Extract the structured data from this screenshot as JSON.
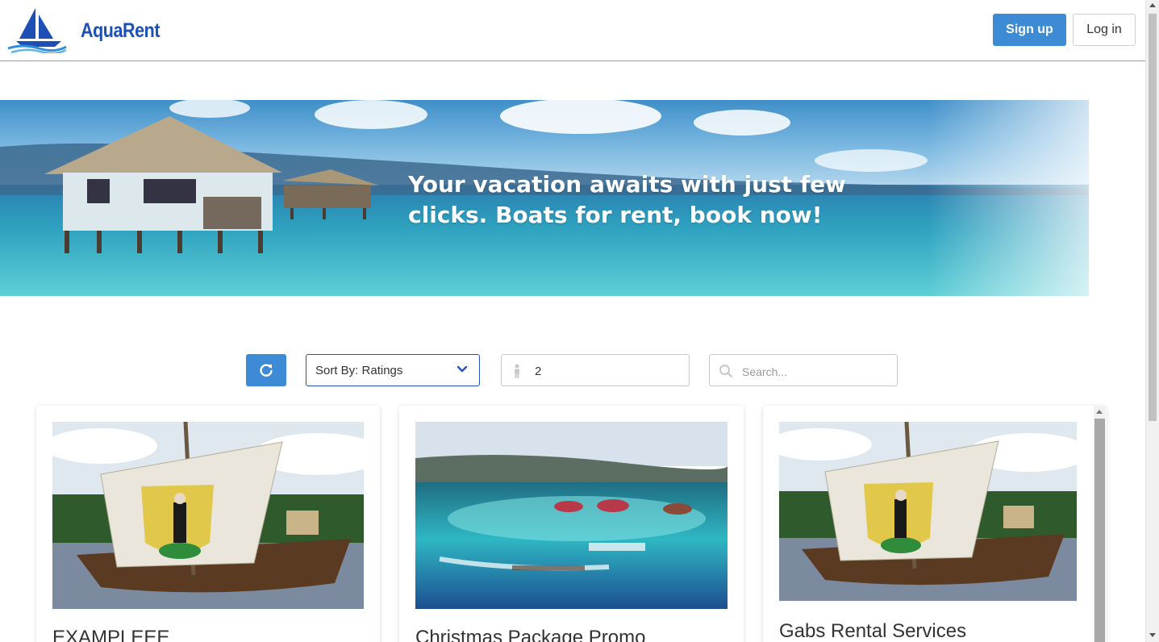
{
  "header": {
    "brand": "AquaRent",
    "signup_label": "Sign up",
    "login_label": "Log in"
  },
  "hero": {
    "line1": "Your vacation awaits with just few",
    "line2": "clicks. Boats for rent, book now!"
  },
  "filters": {
    "sort_label": "Sort By: Ratings",
    "guests_value": "2",
    "search_placeholder": "Search..."
  },
  "listings": [
    {
      "title": "EXAMPLEEE",
      "image": "viking-ship-photo"
    },
    {
      "title": "Christmas Package Promo",
      "image": "tropical-lagoon-photo"
    },
    {
      "title": "Gabs Rental Services",
      "image": "viking-ship-photo"
    }
  ],
  "colors": {
    "primary": "#3d8bd4",
    "brand": "#1c4fb8",
    "select_border": "#2a52be"
  },
  "icons": [
    "sailboat-logo-icon",
    "refresh-icon",
    "chevron-down-icon",
    "person-icon",
    "search-icon"
  ]
}
